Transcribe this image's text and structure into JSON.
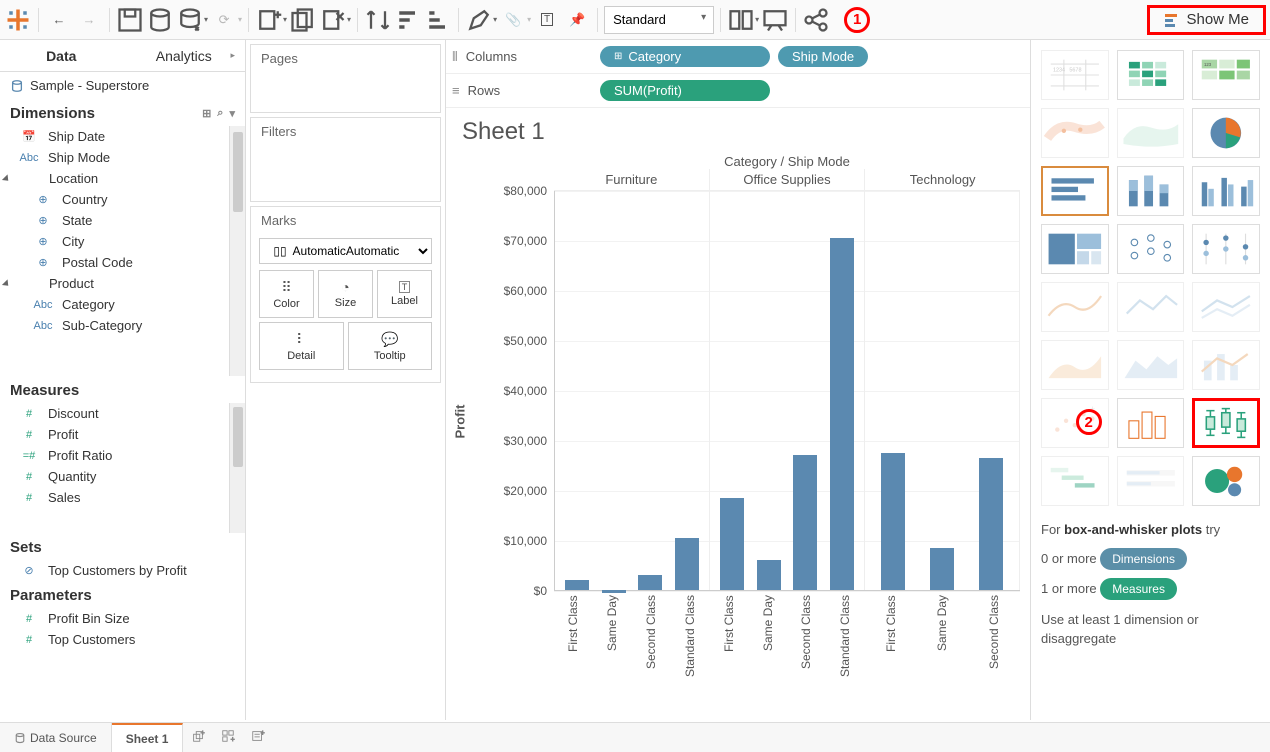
{
  "toolbar": {
    "fit_select": "Standard",
    "showme_label": "Show Me"
  },
  "left": {
    "tab_data": "Data",
    "tab_analytics": "Analytics",
    "datasource": "Sample - Superstore",
    "dimensions_hdr": "Dimensions",
    "measures_hdr": "Measures",
    "sets_hdr": "Sets",
    "params_hdr": "Parameters",
    "dims": {
      "ship_date": "Ship Date",
      "ship_mode": "Ship Mode",
      "location": "Location",
      "country": "Country",
      "state": "State",
      "city": "City",
      "postal": "Postal Code",
      "product": "Product",
      "category": "Category",
      "subcat": "Sub-Category"
    },
    "meas": {
      "discount": "Discount",
      "profit": "Profit",
      "profit_ratio": "Profit Ratio",
      "quantity": "Quantity",
      "sales": "Sales"
    },
    "sets": {
      "top_cust": "Top Customers by Profit"
    },
    "params": {
      "pbs": "Profit Bin Size",
      "tc": "Top Customers"
    }
  },
  "cards": {
    "pages": "Pages",
    "filters": "Filters",
    "marks": "Marks",
    "mark_type": "Automatic",
    "btns": {
      "color": "Color",
      "size": "Size",
      "label": "Label",
      "detail": "Detail",
      "tooltip": "Tooltip"
    }
  },
  "shelves": {
    "columns_label": "Columns",
    "rows_label": "Rows",
    "col_pill1": "Category",
    "col_pill2": "Ship Mode",
    "row_pill1": "SUM(Profit)"
  },
  "sheet_title": "Sheet 1",
  "chart_data": {
    "type": "bar",
    "title": "Sheet 1",
    "header_title": "Category  /  Ship Mode",
    "categories": [
      "Furniture",
      "Office Supplies",
      "Technology"
    ],
    "subcategories": [
      "First Class",
      "Same Day",
      "Second Class",
      "Standard Class"
    ],
    "ylabel": "Profit",
    "ylim": [
      0,
      80000
    ],
    "yticks": [
      0,
      10000,
      20000,
      30000,
      40000,
      50000,
      60000,
      70000,
      80000
    ],
    "ytick_labels": [
      "$0",
      "$10,000",
      "$20,000",
      "$30,000",
      "$40,000",
      "$50,000",
      "$60,000",
      "$70,000",
      "$80,000"
    ],
    "series": [
      {
        "name": "Furniture",
        "values": [
          2000,
          -500,
          3000,
          10500
        ]
      },
      {
        "name": "Office Supplies",
        "values": [
          18500,
          6000,
          27000,
          70500
        ]
      },
      {
        "name": "Technology",
        "values": [
          27500,
          8500,
          26500,
          null
        ]
      }
    ]
  },
  "showme": {
    "rec_prefix": "For ",
    "rec_type": "box-and-whisker plots",
    "rec_suffix": " try",
    "line1_prefix": "0 or more ",
    "chip_dim": "Dimensions",
    "line2_prefix": "1 or more ",
    "chip_meas": "Measures",
    "footer": "Use at least 1 dimension or disaggregate"
  },
  "bottom": {
    "data_source": "Data Source",
    "sheet1": "Sheet 1"
  }
}
